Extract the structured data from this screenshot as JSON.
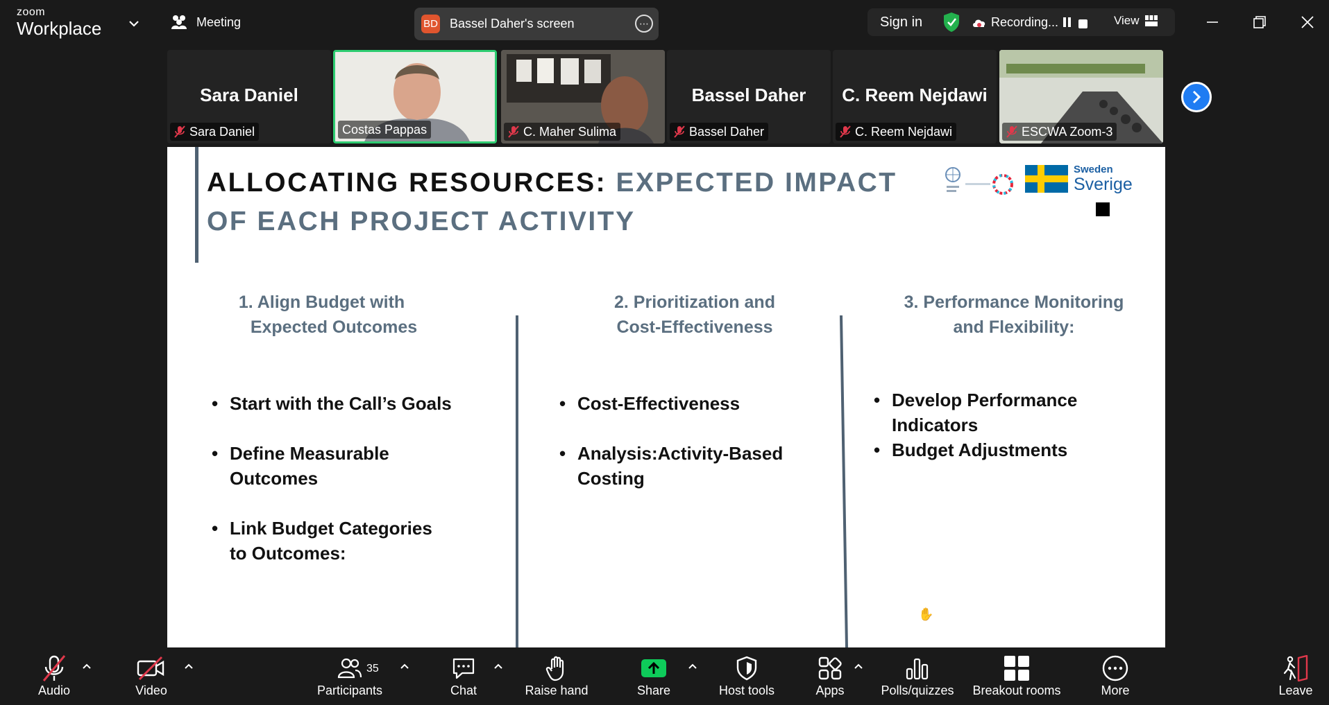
{
  "app": {
    "brand_top": "zoom",
    "brand_bottom": "Workplace",
    "meeting_label": "Meeting",
    "share_avatar": "BD",
    "share_title": "Bassel Daher's screen",
    "sign_in": "Sign in",
    "recording": "Recording...",
    "view": "View"
  },
  "participants_strip": [
    {
      "big_name": "Sara Daniel",
      "tag": "Sara Daniel",
      "muted": true,
      "video": false
    },
    {
      "big_name": "",
      "tag": "Costas Pappas",
      "muted": false,
      "video": true,
      "active": true
    },
    {
      "big_name": "",
      "tag": "C. Maher Sulima",
      "muted": true,
      "video": true
    },
    {
      "big_name": "Bassel Daher",
      "tag": "Bassel Daher",
      "muted": true,
      "video": false
    },
    {
      "big_name": "C. Reem Nejdawi",
      "tag": "C. Reem Nejdawi",
      "muted": true,
      "video": false
    },
    {
      "big_name": "",
      "tag": "ESCWA Zoom-3",
      "muted": true,
      "video": true
    }
  ],
  "slide": {
    "title_part1": "ALLOCATING RESOURCES: ",
    "title_part2": "EXPECTED IMPACT OF EACH PROJECT ACTIVITY",
    "logo_sweden": "Sweden",
    "logo_sverige": "Sverige",
    "columns": [
      {
        "heading_line1": "1. Align Budget with",
        "heading_line2": "Expected Outcomes",
        "bullets": [
          "Start with the Call’s Goals",
          "Define Measurable Outcomes",
          "Link Budget Categories to Outcomes:"
        ]
      },
      {
        "heading_line1": "2. Prioritization and",
        "heading_line2": "Cost-Effectiveness",
        "bullets": [
          "Cost-Effectiveness",
          "Analysis:Activity-Based Costing"
        ]
      },
      {
        "heading_line1": "3. Performance Monitoring",
        "heading_line2": "and Flexibility:",
        "bullets": [
          "Develop Performance Indicators",
          "Budget Adjustments"
        ]
      }
    ]
  },
  "toolbar": {
    "audio": "Audio",
    "video": "Video",
    "participants": "Participants",
    "participants_count": "35",
    "chat": "Chat",
    "raise_hand": "Raise hand",
    "share": "Share",
    "host_tools": "Host tools",
    "apps": "Apps",
    "polls": "Polls/quizzes",
    "breakout": "Breakout rooms",
    "more": "More",
    "leave": "Leave"
  },
  "colors": {
    "accent_green": "#2ecc71",
    "share_green": "#0ecb5a",
    "next_blue": "#1f7cf2",
    "slide_heading": "#5b6f80",
    "muted_red": "#e0384b"
  }
}
